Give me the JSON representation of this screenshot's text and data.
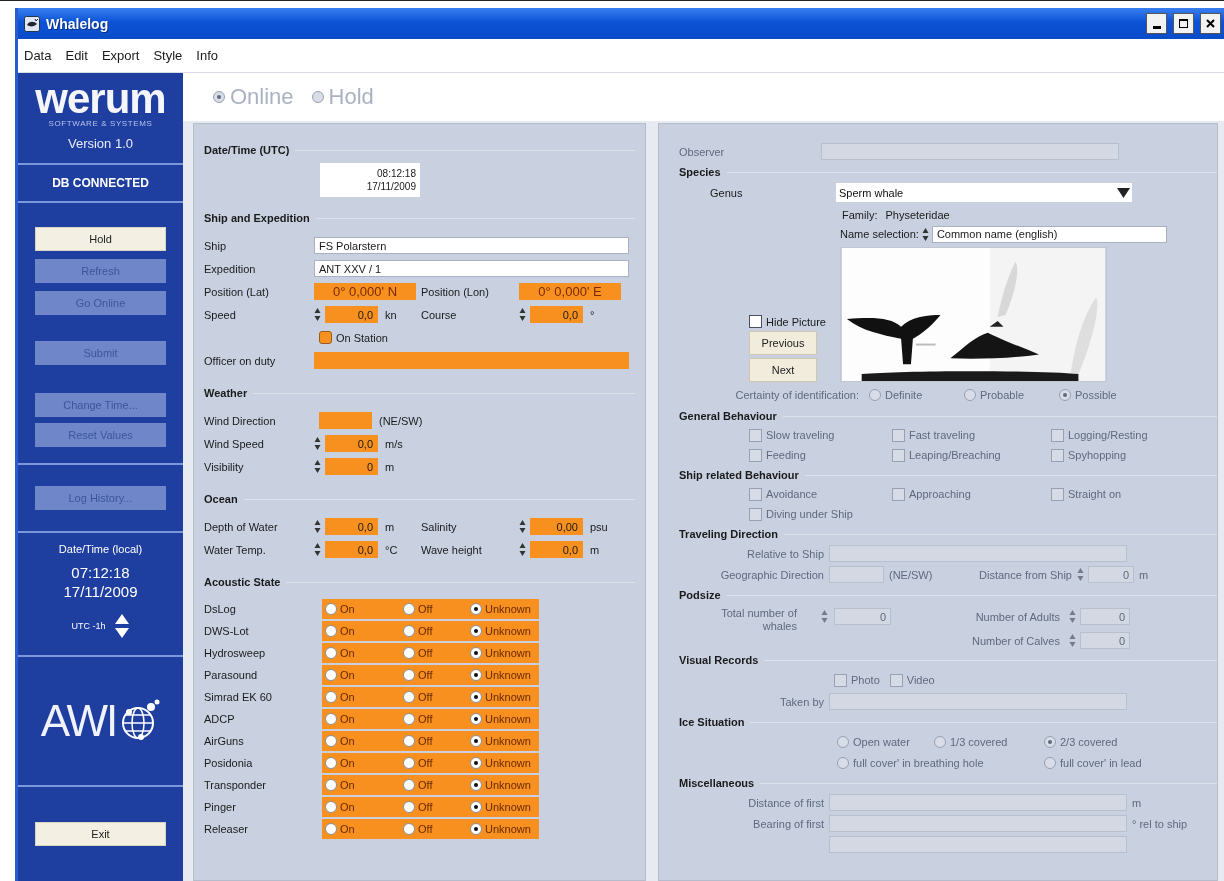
{
  "window": {
    "title": "Whalelog"
  },
  "menu": [
    {
      "label": "Data"
    },
    {
      "label": "Edit"
    },
    {
      "label": "Export"
    },
    {
      "label": "Style"
    },
    {
      "label": "Info"
    }
  ],
  "sidebar": {
    "logo": "werum",
    "logo_tagline": "SOFTWARE & SYSTEMS",
    "version": "Version 1.0",
    "db_status": "DB CONNECTED",
    "button_groups": [
      [
        {
          "label": "Hold",
          "disabled": false
        },
        {
          "label": "Refresh",
          "disabled": true
        },
        {
          "label": "Go Online",
          "disabled": true
        }
      ],
      [
        {
          "label": "Submit",
          "disabled": true
        }
      ],
      [
        {
          "label": "Change Time...",
          "disabled": true
        },
        {
          "label": "Reset Values",
          "disabled": true
        }
      ]
    ],
    "history_button": {
      "label": "Log History...",
      "disabled": true
    },
    "local_time": {
      "label": "Date/Time (local)",
      "time": "07:12:18",
      "date": "17/11/2009",
      "offset": "UTC -1h"
    },
    "institute_logo": "AWI",
    "exit_button": {
      "label": "Exit",
      "disabled": false
    }
  },
  "mode": {
    "disabled": true,
    "options": [
      {
        "label": "Online",
        "selected": true
      },
      {
        "label": "Hold",
        "selected": false
      }
    ]
  },
  "left_panel": {
    "utc": {
      "label": "Date/Time (UTC)",
      "time": "08:12:18",
      "date": "17/11/2009"
    },
    "sections": [
      {
        "title": "Ship and Expedition",
        "rows": [
          {
            "label": "Ship",
            "field": {
              "kind": "wide",
              "value": "FS Polarstern",
              "highlighted": false
            }
          },
          {
            "label": "Expedition",
            "field": {
              "kind": "wide",
              "value": "ANT XXV / 1",
              "highlighted": false
            }
          },
          {
            "label": "Position (Lat)",
            "field": {
              "kind": "coord",
              "value": "0° 0,000' N",
              "highlighted": true
            },
            "label2": "Position (Lon)",
            "field2": {
              "kind": "coord",
              "value": "0° 0,000' E",
              "highlighted": true
            }
          },
          {
            "label": "Speed",
            "field": {
              "kind": "spin",
              "value": "0,0",
              "unit": "kn",
              "highlighted": true
            },
            "label2": "Course",
            "field2": {
              "kind": "spin",
              "value": "0,0",
              "unit": "°",
              "highlighted": true
            }
          },
          {
            "field": {
              "kind": "checkbox",
              "label": "On Station",
              "checked": false,
              "highlighted": true
            }
          },
          {
            "label": "Officer on duty",
            "field": {
              "kind": "wide",
              "highlighted": true
            }
          }
        ]
      },
      {
        "title": "Weather",
        "rows": [
          {
            "label": "Wind Direction",
            "field": {
              "kind": "short",
              "unit": "(NE/SW)",
              "highlighted": true
            }
          },
          {
            "label": "Wind Speed",
            "field": {
              "kind": "spin",
              "value": "0,0",
              "unit": "m/s",
              "highlighted": true
            }
          },
          {
            "label": "Visibility",
            "field": {
              "kind": "spin",
              "value": "0",
              "unit": "m",
              "highlighted": true
            }
          }
        ]
      },
      {
        "title": "Ocean",
        "rows": [
          {
            "label": "Depth of Water",
            "field": {
              "kind": "spin",
              "value": "0,0",
              "unit": "m",
              "highlighted": true
            },
            "label2": "Salinity",
            "field2": {
              "kind": "spin",
              "value": "0,00",
              "unit": "psu",
              "highlighted": true
            }
          },
          {
            "label": "Water Temp.",
            "field": {
              "kind": "spin",
              "value": "0,0",
              "unit": "°C",
              "highlighted": true
            },
            "label2": "Wave height",
            "field2": {
              "kind": "spin",
              "value": "0,0",
              "unit": "m",
              "highlighted": true
            }
          }
        ]
      }
    ],
    "acoustic": {
      "title": "Acoustic State",
      "rows": [
        {
          "label": "DsLog",
          "options": [
            {
              "label": "On",
              "selected": false
            },
            {
              "label": "Off",
              "selected": false
            },
            {
              "label": "Unknown",
              "selected": true
            }
          ]
        },
        {
          "label": "DWS-Lot",
          "options": [
            {
              "label": "On",
              "selected": false
            },
            {
              "label": "Off",
              "selected": false
            },
            {
              "label": "Unknown",
              "selected": true
            }
          ]
        },
        {
          "label": "Hydrosweep",
          "options": [
            {
              "label": "On",
              "selected": false
            },
            {
              "label": "Off",
              "selected": false
            },
            {
              "label": "Unknown",
              "selected": true
            }
          ]
        },
        {
          "label": "Parasound",
          "options": [
            {
              "label": "On",
              "selected": false
            },
            {
              "label": "Off",
              "selected": false
            },
            {
              "label": "Unknown",
              "selected": true
            }
          ]
        },
        {
          "label": "Simrad EK 60",
          "options": [
            {
              "label": "On",
              "selected": false
            },
            {
              "label": "Off",
              "selected": false
            },
            {
              "label": "Unknown",
              "selected": true
            }
          ]
        },
        {
          "label": "ADCP",
          "options": [
            {
              "label": "On",
              "selected": false
            },
            {
              "label": "Off",
              "selected": false
            },
            {
              "label": "Unknown",
              "selected": true
            }
          ]
        },
        {
          "label": "AirGuns",
          "options": [
            {
              "label": "On",
              "selected": false
            },
            {
              "label": "Off",
              "selected": false
            },
            {
              "label": "Unknown",
              "selected": true
            }
          ]
        },
        {
          "label": "Posidonia",
          "options": [
            {
              "label": "On",
              "selected": false
            },
            {
              "label": "Off",
              "selected": false
            },
            {
              "label": "Unknown",
              "selected": true
            }
          ]
        },
        {
          "label": "Transponder",
          "options": [
            {
              "label": "On",
              "selected": false
            },
            {
              "label": "Off",
              "selected": false
            },
            {
              "label": "Unknown",
              "selected": true
            }
          ]
        },
        {
          "label": "Pinger",
          "options": [
            {
              "label": "On",
              "selected": false
            },
            {
              "label": "Off",
              "selected": false
            },
            {
              "label": "Unknown",
              "selected": true
            }
          ]
        },
        {
          "label": "Releaser",
          "options": [
            {
              "label": "On",
              "selected": false
            },
            {
              "label": "Off",
              "selected": false
            },
            {
              "label": "Unknown",
              "selected": true
            }
          ]
        }
      ]
    }
  },
  "right_panel": {
    "observer": {
      "label": "Observer",
      "disabled": true
    },
    "sections": [
      {
        "title": "Species",
        "items": [
          {
            "kind": "dropdown",
            "label": "Genus",
            "value": "Sperm whale",
            "disabled": false
          },
          {
            "kind": "info",
            "label": "Family:",
            "value": "Physeteridae",
            "disabled": false
          },
          {
            "kind": "spin-select",
            "label": "Name selection:",
            "value": "Common name (english)",
            "disabled": false
          },
          {
            "kind": "picture",
            "hide_label": "Hide Picture",
            "hide_checked": false,
            "buttons": [
              {
                "label": "Previous"
              },
              {
                "label": "Next"
              }
            ],
            "disabled": false
          },
          {
            "kind": "radios",
            "label": "Certainty of identification:",
            "disabled": true,
            "options": [
              {
                "label": "Definite",
                "selected": false
              },
              {
                "label": "Probable",
                "selected": false
              },
              {
                "label": "Possible",
                "selected": true
              }
            ]
          }
        ]
      },
      {
        "title": "General Behaviour",
        "items": [
          {
            "kind": "checks",
            "disabled": true,
            "options": [
              {
                "label": "Slow traveling",
                "checked": false
              },
              {
                "label": "Fast traveling",
                "checked": false
              },
              {
                "label": "Logging/Resting",
                "checked": false
              },
              {
                "label": "Feeding",
                "checked": false
              },
              {
                "label": "Leaping/Breaching",
                "checked": false
              },
              {
                "label": "Spyhopping",
                "checked": false
              }
            ]
          }
        ]
      },
      {
        "title": "Ship related Behaviour",
        "items": [
          {
            "kind": "checks",
            "disabled": true,
            "options": [
              {
                "label": "Avoidance",
                "checked": false
              },
              {
                "label": "Approaching",
                "checked": false
              },
              {
                "label": "Straight on",
                "checked": false
              },
              {
                "label": "Diving under Ship",
                "checked": false
              }
            ]
          }
        ]
      },
      {
        "title": "Traveling Direction",
        "items": [
          {
            "kind": "field",
            "label": "Relative to Ship",
            "disabled": true
          },
          {
            "kind": "geo",
            "label": "Geographic Direction",
            "unit": "(NE/SW)",
            "label2": "Distance from Ship",
            "value2": "0",
            "unit2": "m",
            "disabled": true
          }
        ]
      },
      {
        "title": "Podsize",
        "items": [
          {
            "kind": "pod",
            "label": "Total number of whales",
            "value": "0",
            "label2": "Number of Adults",
            "value2": "0",
            "label3": "Number of Calves",
            "value3": "0",
            "disabled": true
          }
        ]
      },
      {
        "title": "Visual Records",
        "items": [
          {
            "kind": "checks-inline",
            "disabled": true,
            "options": [
              {
                "label": "Photo",
                "checked": false
              },
              {
                "label": "Video",
                "checked": false
              }
            ]
          },
          {
            "kind": "field",
            "label": "Taken by",
            "disabled": true
          }
        ]
      },
      {
        "title": "Ice Situation",
        "items": [
          {
            "kind": "radio-grid",
            "disabled": true,
            "options": [
              {
                "label": "Open water",
                "selected": false
              },
              {
                "label": "1/3 covered",
                "selected": false
              },
              {
                "label": "2/3 covered",
                "selected": true
              },
              {
                "label": "full cover' in breathing hole",
                "selected": false
              },
              {
                "label": "full cover' in lead",
                "selected": false
              }
            ]
          }
        ]
      },
      {
        "title": "Miscellaneous",
        "items": [
          {
            "kind": "field",
            "label": "Distance of first",
            "unit": "m",
            "disabled": true
          },
          {
            "kind": "field",
            "label": "Bearing of first",
            "unit": "° rel to ship",
            "disabled": true
          },
          {
            "kind": "field",
            "disabled": true
          }
        ]
      }
    ]
  }
}
